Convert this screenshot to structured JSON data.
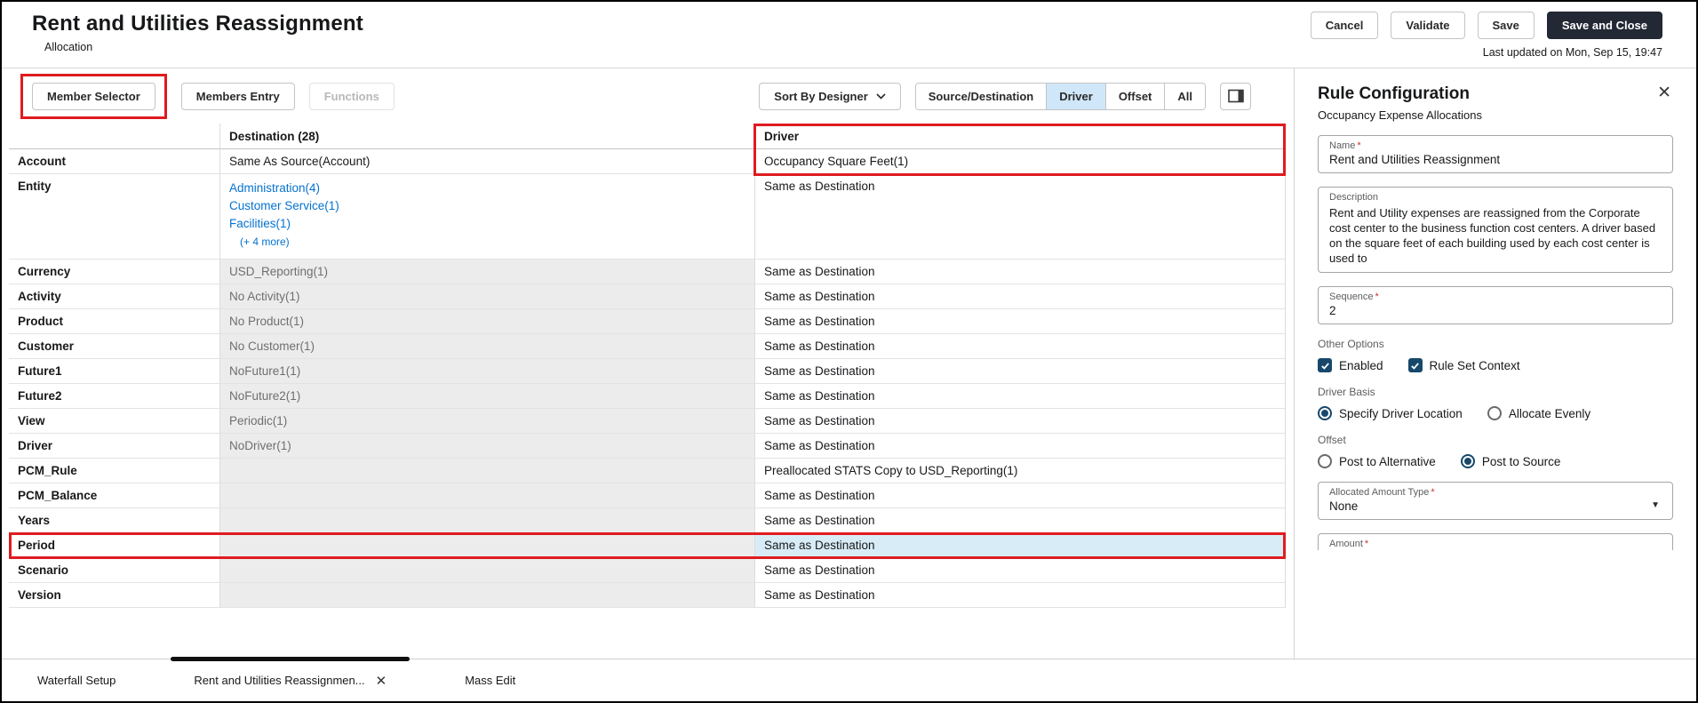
{
  "colors": {
    "annotation_red": "#e01b20",
    "link_blue": "#0572ce",
    "selected_cell_blue": "#d8ecf7",
    "segment_selected_blue": "#cfe7f8",
    "primary_button": "#222834",
    "check_control": "#17486b"
  },
  "header": {
    "title": "Rent and Utilities Reassignment",
    "subtitle": "Allocation",
    "last_updated": "Last updated on Mon, Sep 15, 19:47",
    "buttons": {
      "cancel": "Cancel",
      "validate": "Validate",
      "save": "Save",
      "save_and_close": "Save and Close"
    }
  },
  "toolbar": {
    "member_selector": "Member Selector",
    "members_entry": "Members Entry",
    "functions": "Functions",
    "sort_by": "Sort By Designer",
    "segments": [
      {
        "label": "Source/Destination",
        "selected": false
      },
      {
        "label": "Driver",
        "selected": true
      },
      {
        "label": "Offset",
        "selected": false
      },
      {
        "label": "All",
        "selected": false
      }
    ]
  },
  "grid": {
    "columns": {
      "destination": "Destination (28)",
      "driver": "Driver"
    },
    "rows": [
      {
        "label": "Account",
        "destination": "Same As Source(Account)",
        "driver": "Occupancy Square Feet(1)"
      },
      {
        "label": "Entity",
        "dest_links": [
          "Administration(4)",
          "Customer Service(1)",
          "Facilities(1)"
        ],
        "dest_more": "(+ 4 more)",
        "driver": "Same as Destination"
      },
      {
        "label": "Currency",
        "destination": "USD_Reporting(1)",
        "driver": "Same as Destination"
      },
      {
        "label": "Activity",
        "destination": "No Activity(1)",
        "driver": "Same as Destination"
      },
      {
        "label": "Product",
        "destination": "No Product(1)",
        "driver": "Same as Destination"
      },
      {
        "label": "Customer",
        "destination": "No Customer(1)",
        "driver": "Same as Destination"
      },
      {
        "label": "Future1",
        "destination": "NoFuture1(1)",
        "driver": "Same as Destination"
      },
      {
        "label": "Future2",
        "destination": "NoFuture2(1)",
        "driver": "Same as Destination"
      },
      {
        "label": "View",
        "destination": "Periodic(1)",
        "driver": "Same as Destination"
      },
      {
        "label": "Driver",
        "destination": "NoDriver(1)",
        "driver": "Same as Destination"
      },
      {
        "label": "PCM_Rule",
        "destination": "",
        "driver": "Preallocated STATS Copy to USD_Reporting(1)"
      },
      {
        "label": "PCM_Balance",
        "destination": "",
        "driver": "Same as Destination"
      },
      {
        "label": "Years",
        "destination": "",
        "driver": "Same as Destination"
      },
      {
        "label": "Period",
        "destination": "",
        "driver": "Same as Destination"
      },
      {
        "label": "Scenario",
        "destination": "",
        "driver": "Same as Destination"
      },
      {
        "label": "Version",
        "destination": "",
        "driver": "Same as Destination"
      }
    ]
  },
  "panel": {
    "title": "Rule Configuration",
    "subtitle": "Occupancy Expense Allocations",
    "name_label": "Name",
    "name_value": "Rent and Utilities Reassignment",
    "description_label": "Description",
    "description_value": "Rent and Utility expenses are reassigned from the Corporate cost center to the business function cost centers. A driver based on the square feet of each building used by each cost center is used to",
    "sequence_label": "Sequence",
    "sequence_value": "2",
    "other_options_label": "Other Options",
    "checkbox_enabled": "Enabled",
    "checkbox_rule_set_context": "Rule Set Context",
    "driver_basis_label": "Driver Basis",
    "radio_specify_driver": "Specify Driver Location",
    "radio_allocate_evenly": "Allocate Evenly",
    "offset_label": "Offset",
    "radio_post_alternative": "Post to Alternative",
    "radio_post_source": "Post to Source",
    "allocated_amount_type_label": "Allocated Amount Type",
    "allocated_amount_type_value": "None",
    "amount_label": "Amount"
  },
  "tabs": [
    {
      "label": "Waterfall Setup",
      "active": false
    },
    {
      "label": "Rent and Utilities Reassignmen...",
      "active": true,
      "closable": true
    },
    {
      "label": "Mass Edit",
      "active": false
    }
  ]
}
